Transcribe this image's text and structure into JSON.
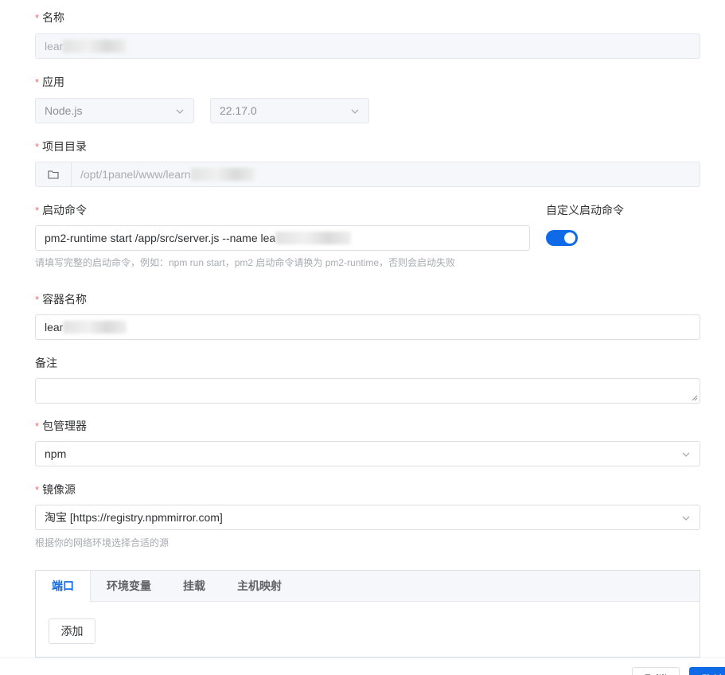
{
  "form": {
    "name": {
      "label": "名称",
      "value": "lear"
    },
    "app": {
      "label": "应用",
      "runtime": "Node.js",
      "version": "22.17.0"
    },
    "directory": {
      "label": "项目目录",
      "value": "/opt/1panel/www/learn"
    },
    "command": {
      "label": "启动命令",
      "value": "pm2-runtime start /app/src/server.js --name lea",
      "custom_label": "自定义启动命令",
      "custom_enabled": true,
      "hint": "请填写完整的启动命令，例如：npm run start，pm2 启动命令请换为 pm2-runtime，否则会启动失败"
    },
    "container": {
      "label": "容器名称",
      "value": "lear"
    },
    "remark": {
      "label": "备注",
      "value": ""
    },
    "package_manager": {
      "label": "包管理器",
      "value": "npm"
    },
    "mirror": {
      "label": "镜像源",
      "value": "淘宝 [https://registry.npmmirror.com]",
      "hint": "根据你的网络环境选择合适的源"
    },
    "tabs": [
      {
        "label": "端口",
        "active": true
      },
      {
        "label": "环境变量",
        "active": false
      },
      {
        "label": "挂载",
        "active": false
      },
      {
        "label": "主机映射",
        "active": false
      }
    ],
    "add_label": "添加",
    "required_mark": "*"
  },
  "footer": {
    "cancel_label": "取消",
    "confirm_label": "确认"
  },
  "colors": {
    "accent": "#0f6ae8",
    "required": "#f56c6c"
  }
}
